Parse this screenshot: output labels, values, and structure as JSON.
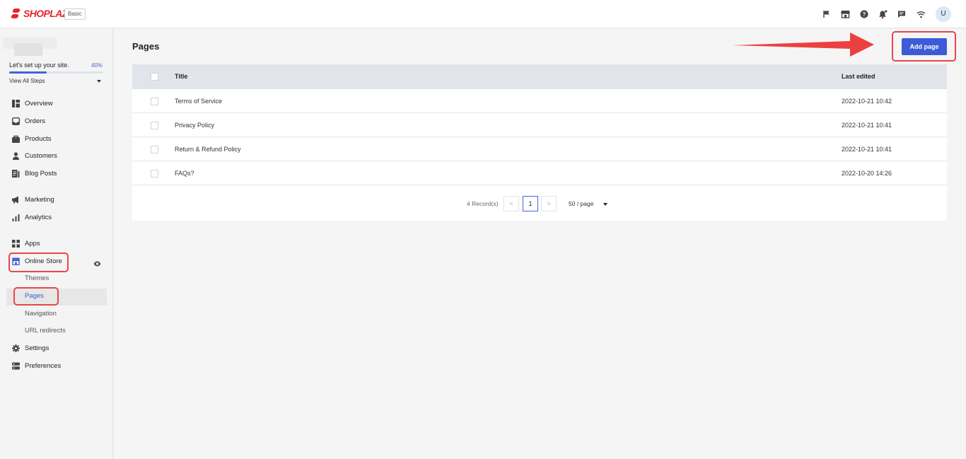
{
  "brand": {
    "logo_text": "SHOPLAZZA",
    "plan": "Basic",
    "accent": "#e8242d"
  },
  "header": {
    "icons": [
      "flag-icon",
      "store-icon",
      "help-icon",
      "bell-icon",
      "chat-icon",
      "wifi-icon"
    ],
    "avatar_letter": "U"
  },
  "setup": {
    "title": "Let's set up your site.",
    "percent": "40%",
    "progress": 0.4,
    "view_all": "View All Steps"
  },
  "sidebar": {
    "items": [
      {
        "label": "Overview",
        "icon": "overview-icon"
      },
      {
        "label": "Orders",
        "icon": "orders-icon"
      },
      {
        "label": "Products",
        "icon": "products-icon"
      },
      {
        "label": "Customers",
        "icon": "customers-icon"
      },
      {
        "label": "Blog Posts",
        "icon": "blog-icon"
      },
      {
        "label": "Marketing",
        "icon": "megaphone-icon"
      },
      {
        "label": "Analytics",
        "icon": "analytics-icon"
      },
      {
        "label": "Apps",
        "icon": "apps-icon"
      },
      {
        "label": "Online Store",
        "icon": "store-icon"
      },
      {
        "label": "Settings",
        "icon": "gear-icon"
      },
      {
        "label": "Preferences",
        "icon": "preferences-icon"
      }
    ],
    "sub_items": [
      {
        "label": "Themes"
      },
      {
        "label": "Pages",
        "active": true
      },
      {
        "label": "Navigation"
      },
      {
        "label": "URL redirects"
      }
    ]
  },
  "main": {
    "title": "Pages",
    "add_button": "Add page",
    "table": {
      "headers": {
        "title": "Title",
        "last_edited": "Last edited"
      },
      "rows": [
        {
          "title": "Terms of Service",
          "last_edited": "2022-10-21 10:42"
        },
        {
          "title": "Privacy Policy",
          "last_edited": "2022-10-21 10:41"
        },
        {
          "title": "Return & Refund Policy",
          "last_edited": "2022-10-21 10:41"
        },
        {
          "title": "FAQs?",
          "last_edited": "2022-10-20 14:26"
        }
      ]
    },
    "pagination": {
      "records": "4 Record(s)",
      "prev": "<",
      "current": "1",
      "next": ">",
      "per_page": "50 / page"
    }
  },
  "colors": {
    "primary": "#3d5bd6",
    "highlight": "#e8464b"
  }
}
